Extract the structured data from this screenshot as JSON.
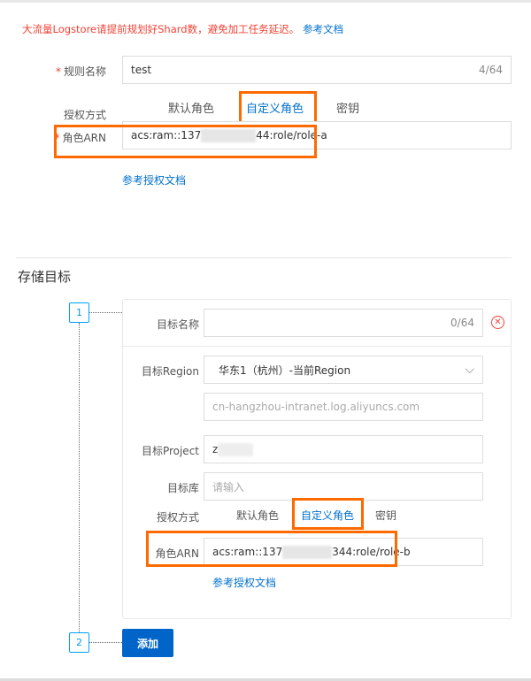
{
  "warning": {
    "text": "大流量Logstore请提前规划好Shard数，避免加工任务延迟。",
    "link": "参考文档"
  },
  "rule": {
    "name_label": "规则名称",
    "name_value": "test",
    "name_count": "4/64",
    "auth_label": "授权方式",
    "tabs": [
      "默认角色",
      "自定义角色",
      "密钥"
    ],
    "arn_label": "角色ARN",
    "arn_prefix": "acs:ram::137",
    "arn_suffix": "44:role/role-a",
    "auth_doc_link": "参考授权文档"
  },
  "storage": {
    "title": "存储目标",
    "steps": [
      "1",
      "2"
    ],
    "target": {
      "name_label": "目标名称",
      "name_count": "0/64",
      "region_label": "目标Region",
      "region_value": "华东1（杭州）-当前Region",
      "endpoint_placeholder": "cn-hangzhou-intranet.log.aliyuncs.com",
      "project_label": "目标Project",
      "project_value": "z",
      "store_label": "目标库",
      "store_placeholder": "请输入",
      "auth_label": "授权方式",
      "tabs": [
        "默认角色",
        "自定义角色",
        "密钥"
      ],
      "arn_label": "角色ARN",
      "arn_prefix": "acs:ram::137",
      "arn_suffix": "344:role/role-b",
      "auth_doc_link": "参考授权文档"
    },
    "add_button": "添加"
  }
}
